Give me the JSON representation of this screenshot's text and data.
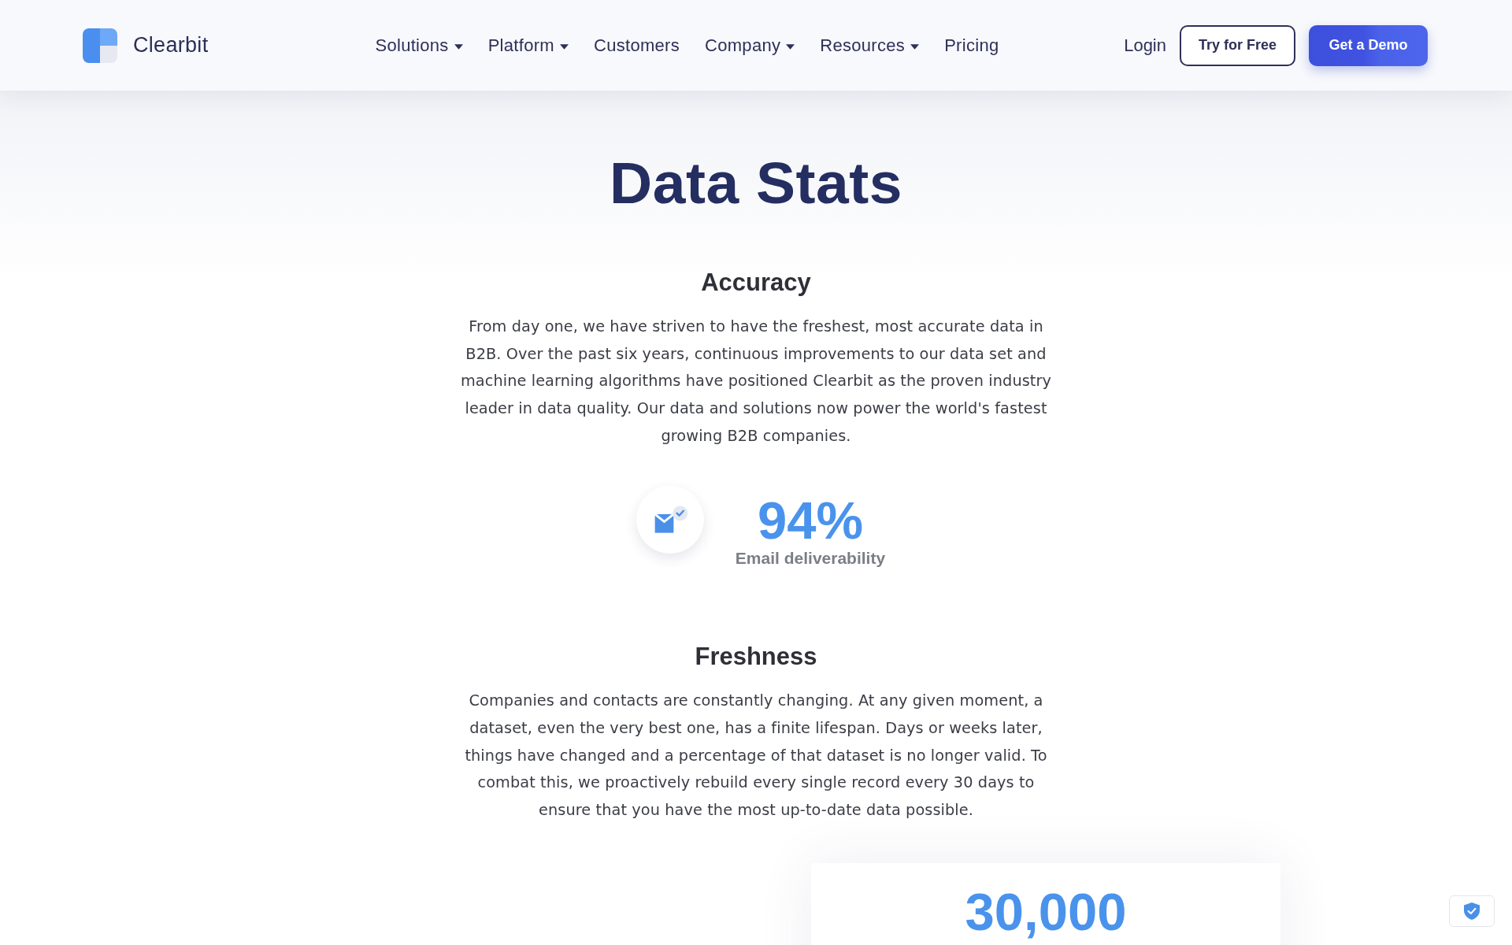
{
  "header": {
    "logo": {
      "text": "Clearbit"
    },
    "nav": [
      {
        "label": "Solutions",
        "kind": "menu"
      },
      {
        "label": "Platform",
        "kind": "menu"
      },
      {
        "label": "Customers",
        "kind": "link"
      },
      {
        "label": "Company",
        "kind": "menu"
      },
      {
        "label": "Resources",
        "kind": "menu"
      },
      {
        "label": "Pricing",
        "kind": "link"
      }
    ],
    "login": "Login",
    "buttons": [
      {
        "label": "Try for Free",
        "kind": "outline"
      },
      {
        "label": "Get a Demo",
        "kind": "primary"
      }
    ]
  },
  "title": "Data Stats",
  "sections": [
    {
      "heading": "Accuracy",
      "text": "From day one, we have striven to have the freshest, most accurate data in B2B. Over the past six years, continuous improvements to our data set and machine learning algorithms have positioned Clearbit as the proven industry leader in data quality. Our data and solutions now power the world's fastest growing B2B companies.",
      "stat": {
        "kind": "icon",
        "value": "94%",
        "label": "Email deliverability"
      }
    },
    {
      "heading": "Freshness",
      "text": "Companies and contacts are constantly changing. At any given moment, a dataset, even the very best one, has a finite lifespan. Days or weeks later, things have changed and a percentage of that dataset is no longer valid. To combat this, we proactively rebuild every single record every 30 days to ensure that you have the most up-to-date data possible.",
      "stat": {
        "kind": "card",
        "value": "30,000"
      }
    }
  ]
}
